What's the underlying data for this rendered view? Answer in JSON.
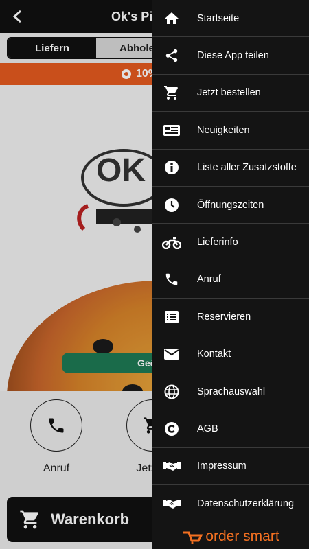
{
  "header": {
    "title": "Ok's Piz",
    "back_icon": "back-arrow-icon"
  },
  "order_type": {
    "tabs": [
      "Liefern",
      "Abholen"
    ],
    "selected": "Liefern"
  },
  "promo": {
    "text": "10%"
  },
  "hero": {
    "button_label": "Geö"
  },
  "actions": [
    {
      "label": "Anruf",
      "icon": "phone-icon"
    },
    {
      "label": "Jetzt b",
      "icon": "cart-icon"
    }
  ],
  "cart": {
    "label": "Warenkorb"
  },
  "drawer": {
    "items": [
      {
        "label": "Startseite",
        "icon": "home-icon"
      },
      {
        "label": "Diese App teilen",
        "icon": "share-icon"
      },
      {
        "label": "Jetzt bestellen",
        "icon": "cart-icon"
      },
      {
        "label": "Neuigkeiten",
        "icon": "news-icon"
      },
      {
        "label": "Liste aller Zusatzstoffe",
        "icon": "info-icon"
      },
      {
        "label": "Öffnungszeiten",
        "icon": "clock-icon"
      },
      {
        "label": "Lieferinfo",
        "icon": "motorcycle-icon"
      },
      {
        "label": "Anruf",
        "icon": "phone-icon"
      },
      {
        "label": "Reservieren",
        "icon": "list-icon"
      },
      {
        "label": "Kontakt",
        "icon": "mail-icon"
      },
      {
        "label": "Sprachauswahl",
        "icon": "globe-icon"
      },
      {
        "label": "AGB",
        "icon": "copyright-icon"
      },
      {
        "label": "Impressum",
        "icon": "handshake-icon"
      },
      {
        "label": "Datenschutzerklärung",
        "icon": "handshake-icon"
      }
    ],
    "brand": "order smart",
    "brand_color": "#f37021"
  },
  "colors": {
    "bar": "#111111",
    "promo": "#e55a1f",
    "accent_green": "#1e7a55"
  }
}
